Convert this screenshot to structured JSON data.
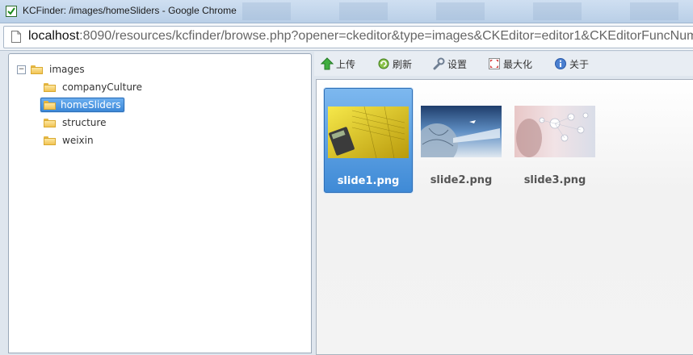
{
  "window": {
    "title": "KCFinder: /images/homeSliders - Google Chrome"
  },
  "address": {
    "host": "localhost",
    "path": ":8090/resources/kcfinder/browse.php?opener=ckeditor&type=images&CKEditor=editor1&CKEditorFuncNum"
  },
  "tree": {
    "root": {
      "label": "images",
      "expanded": true
    },
    "children": [
      {
        "label": "companyCulture",
        "selected": false
      },
      {
        "label": "homeSliders",
        "selected": true
      },
      {
        "label": "structure",
        "selected": false
      },
      {
        "label": "weixin",
        "selected": false
      }
    ]
  },
  "toolbar": {
    "upload": {
      "label": "上传",
      "icon": "upload-arrow-icon"
    },
    "refresh": {
      "label": "刷新",
      "icon": "refresh-icon"
    },
    "settings": {
      "label": "设置",
      "icon": "wrench-icon"
    },
    "maximize": {
      "label": "最大化",
      "icon": "maximize-icon"
    },
    "about": {
      "label": "关于",
      "icon": "info-icon"
    }
  },
  "files": [
    {
      "name": "slide1.png",
      "selected": true
    },
    {
      "name": "slide2.png",
      "selected": false
    },
    {
      "name": "slide3.png",
      "selected": false
    }
  ],
  "colors": {
    "selection": "#3c88d8",
    "accent_folder": "#f1c453"
  }
}
